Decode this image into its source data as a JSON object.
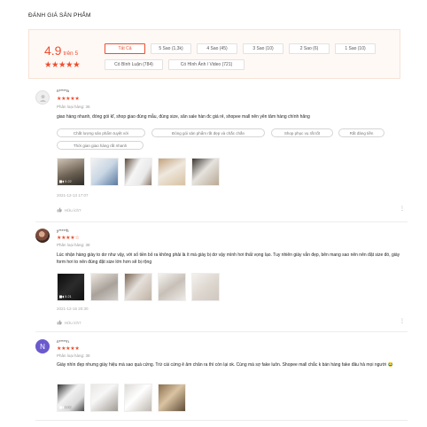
{
  "section": {
    "title": "ĐÁNH GIÁ SẢN PHẨM"
  },
  "summary": {
    "score": "4.9",
    "score_suffix": "trên 5",
    "stars": "★★★★★",
    "filters": [
      {
        "label": "Tất Cả",
        "active": true
      },
      {
        "label": "5 Sao (1,3k)"
      },
      {
        "label": "4 Sao (45)"
      },
      {
        "label": "3 Sao (10)"
      },
      {
        "label": "2 Sao (6)"
      },
      {
        "label": "1 Sao (10)"
      },
      {
        "label": "Có Bình Luận (784)"
      },
      {
        "label": "Có Hình Ảnh / Video (721)"
      }
    ]
  },
  "reviews": [
    {
      "user": "n*****a",
      "stars": "★★★★★",
      "variant": "Phân loại hàng: 36",
      "text": "giao hàng nhanh, đóng gói kĩ, shop giao đúng mẫu, đúng size, săn sale hàn đc giá rẻ, shopee mall nên yên tâm hàng chính hãng",
      "tags": [
        "Chất lượng sản phẩm tuyệt vời",
        "Đóng gói sản phẩm rất đẹp và chắc chắn",
        "Shop phục vụ rất tốt",
        "Rất đáng tiền",
        "Thời gian giao hàng rất nhanh"
      ],
      "video_duration": "0:22",
      "date": "2021-12-13 17:07",
      "help": "Hữu ích?",
      "more": "⋮"
    },
    {
      "user": "y*****h",
      "stars": "★★★★",
      "star_off": "☆",
      "variant": "Phân loại hàng: 38",
      "text": "Lúc nhận hàng giày to dơ như vậy, với số tiền bỏ ra không phải là ít mà giày bị dơ vậy mình hơi thất vọng lạo. Tuy nhiên giày vẫn đẹp, bên mang sao nên nên đặt size đó, giày form hơi to nên đúng đặt size lớn hơn sẽ bị rộng",
      "video_duration": "0:21",
      "date": "2021-12-16 20:30",
      "help": "Hữu ích?",
      "more": "⋮"
    },
    {
      "avatar_letter": "N",
      "user": "n*****n",
      "stars": "★★★★★",
      "variant": "Phân loại hàng: 38",
      "text": "Giày nhìn đẹp nhưng giày hiệu mà sao quá cứng. Trừ cái cứng ê âm chân ra thì còn lại ok. Cùng mà sợ fake luôn. Shopee mall chắc k bán hàng fake đâu hả mọi người 😂",
      "video_duration": "0:06"
    }
  ],
  "icons": {
    "user_placeholder": "user-icon",
    "thumbs_up": "thumbs-up-icon",
    "video": "video-camera-icon",
    "more": "more-vertical-icon"
  },
  "colors": {
    "accent": "#ee4d2d",
    "panel": "#fff9f6"
  }
}
